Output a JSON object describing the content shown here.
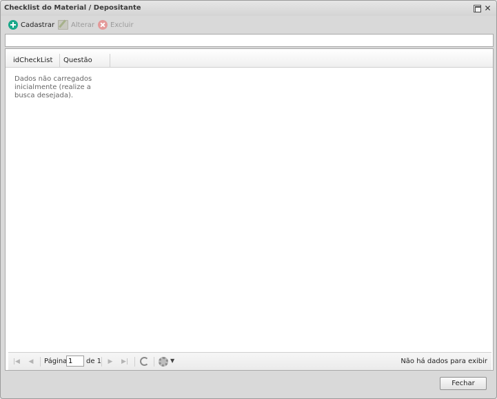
{
  "window": {
    "title": "Checklist do Material / Depositante"
  },
  "toolbar": {
    "add_label": "Cadastrar",
    "edit_label": "Alterar",
    "delete_label": "Excluir"
  },
  "grid": {
    "columns": [
      "idCheckList",
      "Questão"
    ],
    "empty_message": "Dados não carregados inicialmente (realize a busca desejada)."
  },
  "pager": {
    "page_label": "Página",
    "current_page": "1",
    "of_label": "de 1",
    "status": "Não há dados para exibir"
  },
  "footer": {
    "close_label": "Fechar"
  }
}
